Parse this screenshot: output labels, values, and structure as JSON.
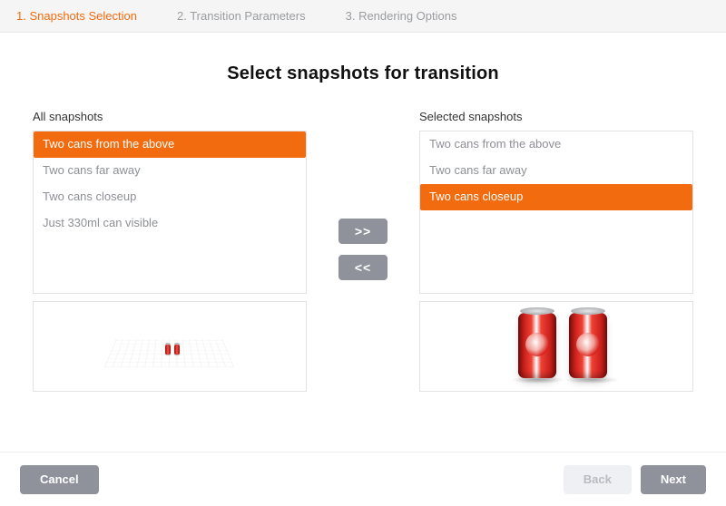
{
  "stepper": {
    "items": [
      {
        "label": "1. Snapshots Selection",
        "active": true
      },
      {
        "label": "2. Transition Parameters",
        "active": false
      },
      {
        "label": "3. Rendering Options",
        "active": false
      }
    ]
  },
  "title": "Select snapshots for transition",
  "left": {
    "heading": "All snapshots",
    "items": [
      {
        "label": "Two cans from the above",
        "selected": true
      },
      {
        "label": "Two cans far away",
        "selected": false
      },
      {
        "label": "Two cans closeup",
        "selected": false
      },
      {
        "label": "Just 330ml can visible",
        "selected": false
      }
    ]
  },
  "right": {
    "heading": "Selected snapshots",
    "items": [
      {
        "label": "Two cans from the above",
        "selected": false
      },
      {
        "label": "Two cans far away",
        "selected": false
      },
      {
        "label": "Two cans closeup",
        "selected": true
      }
    ]
  },
  "move": {
    "add": ">>",
    "remove": "<<"
  },
  "footer": {
    "cancel": "Cancel",
    "back": "Back",
    "next": "Next"
  }
}
